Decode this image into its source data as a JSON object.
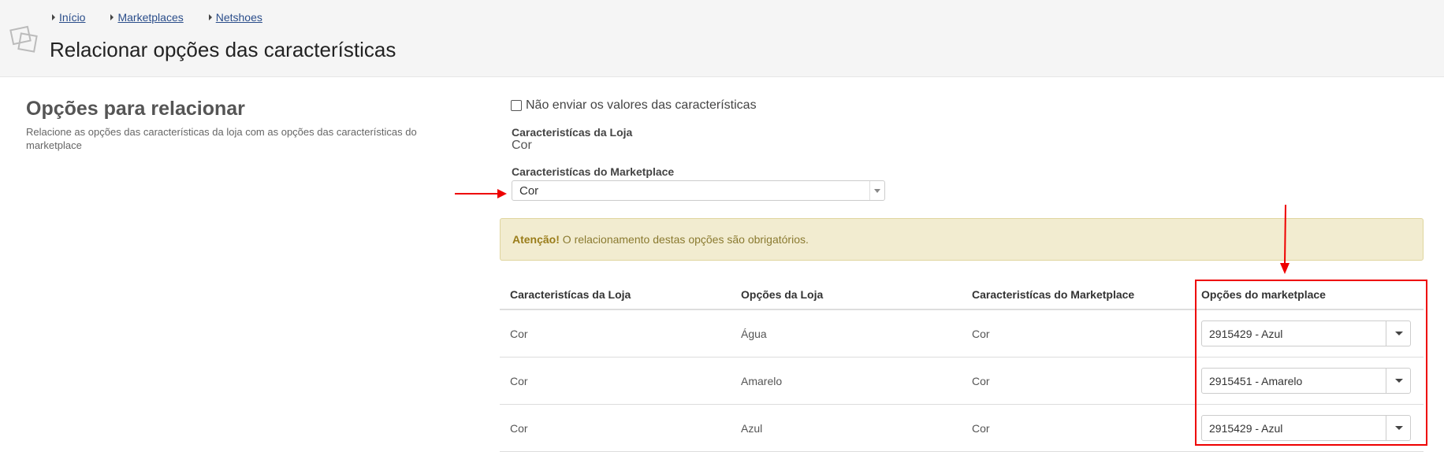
{
  "breadcrumb": [
    {
      "label": "Início"
    },
    {
      "label": "Marketplaces"
    },
    {
      "label": "Netshoes"
    }
  ],
  "page_title": "Relacionar opções das características",
  "section": {
    "title": "Opções para relacionar",
    "description": "Relacione as opções das características da loja com as opções das características do marketplace"
  },
  "form": {
    "no_send_checkbox_label": "Não enviar os valores das características",
    "no_send_checked": false,
    "store_feature_label": "Caracteristícas da Loja",
    "store_feature_value": "Cor",
    "marketplace_feature_label": "Caracteristícas do Marketplace",
    "marketplace_feature_selected": "Cor"
  },
  "alert": {
    "strong": "Atenção!",
    "text": " O relacionamento destas opções são obrigatórios."
  },
  "table": {
    "headers": [
      "Caracteristícas da Loja",
      "Opções da Loja",
      "Caracteristícas do Marketplace",
      "Opções do marketplace"
    ],
    "rows": [
      {
        "store_feature": "Cor",
        "store_option": "Água",
        "marketplace_feature": "Cor",
        "marketplace_option": "2915429 - Azul"
      },
      {
        "store_feature": "Cor",
        "store_option": "Amarelo",
        "marketplace_feature": "Cor",
        "marketplace_option": "2915451 - Amarelo"
      },
      {
        "store_feature": "Cor",
        "store_option": "Azul",
        "marketplace_feature": "Cor",
        "marketplace_option": "2915429 - Azul"
      }
    ]
  },
  "colors": {
    "annotation": "#e00000",
    "alert_bg": "#f2ecd0",
    "link": "#2a4d8a"
  }
}
